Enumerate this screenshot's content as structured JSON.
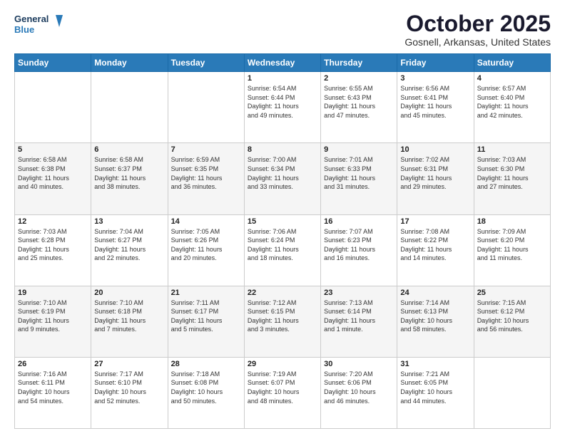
{
  "header": {
    "logo_line1": "General",
    "logo_line2": "Blue",
    "month": "October 2025",
    "location": "Gosnell, Arkansas, United States"
  },
  "weekdays": [
    "Sunday",
    "Monday",
    "Tuesday",
    "Wednesday",
    "Thursday",
    "Friday",
    "Saturday"
  ],
  "weeks": [
    [
      {
        "day": "",
        "info": ""
      },
      {
        "day": "",
        "info": ""
      },
      {
        "day": "",
        "info": ""
      },
      {
        "day": "1",
        "info": "Sunrise: 6:54 AM\nSunset: 6:44 PM\nDaylight: 11 hours\nand 49 minutes."
      },
      {
        "day": "2",
        "info": "Sunrise: 6:55 AM\nSunset: 6:43 PM\nDaylight: 11 hours\nand 47 minutes."
      },
      {
        "day": "3",
        "info": "Sunrise: 6:56 AM\nSunset: 6:41 PM\nDaylight: 11 hours\nand 45 minutes."
      },
      {
        "day": "4",
        "info": "Sunrise: 6:57 AM\nSunset: 6:40 PM\nDaylight: 11 hours\nand 42 minutes."
      }
    ],
    [
      {
        "day": "5",
        "info": "Sunrise: 6:58 AM\nSunset: 6:38 PM\nDaylight: 11 hours\nand 40 minutes."
      },
      {
        "day": "6",
        "info": "Sunrise: 6:58 AM\nSunset: 6:37 PM\nDaylight: 11 hours\nand 38 minutes."
      },
      {
        "day": "7",
        "info": "Sunrise: 6:59 AM\nSunset: 6:35 PM\nDaylight: 11 hours\nand 36 minutes."
      },
      {
        "day": "8",
        "info": "Sunrise: 7:00 AM\nSunset: 6:34 PM\nDaylight: 11 hours\nand 33 minutes."
      },
      {
        "day": "9",
        "info": "Sunrise: 7:01 AM\nSunset: 6:33 PM\nDaylight: 11 hours\nand 31 minutes."
      },
      {
        "day": "10",
        "info": "Sunrise: 7:02 AM\nSunset: 6:31 PM\nDaylight: 11 hours\nand 29 minutes."
      },
      {
        "day": "11",
        "info": "Sunrise: 7:03 AM\nSunset: 6:30 PM\nDaylight: 11 hours\nand 27 minutes."
      }
    ],
    [
      {
        "day": "12",
        "info": "Sunrise: 7:03 AM\nSunset: 6:28 PM\nDaylight: 11 hours\nand 25 minutes."
      },
      {
        "day": "13",
        "info": "Sunrise: 7:04 AM\nSunset: 6:27 PM\nDaylight: 11 hours\nand 22 minutes."
      },
      {
        "day": "14",
        "info": "Sunrise: 7:05 AM\nSunset: 6:26 PM\nDaylight: 11 hours\nand 20 minutes."
      },
      {
        "day": "15",
        "info": "Sunrise: 7:06 AM\nSunset: 6:24 PM\nDaylight: 11 hours\nand 18 minutes."
      },
      {
        "day": "16",
        "info": "Sunrise: 7:07 AM\nSunset: 6:23 PM\nDaylight: 11 hours\nand 16 minutes."
      },
      {
        "day": "17",
        "info": "Sunrise: 7:08 AM\nSunset: 6:22 PM\nDaylight: 11 hours\nand 14 minutes."
      },
      {
        "day": "18",
        "info": "Sunrise: 7:09 AM\nSunset: 6:20 PM\nDaylight: 11 hours\nand 11 minutes."
      }
    ],
    [
      {
        "day": "19",
        "info": "Sunrise: 7:10 AM\nSunset: 6:19 PM\nDaylight: 11 hours\nand 9 minutes."
      },
      {
        "day": "20",
        "info": "Sunrise: 7:10 AM\nSunset: 6:18 PM\nDaylight: 11 hours\nand 7 minutes."
      },
      {
        "day": "21",
        "info": "Sunrise: 7:11 AM\nSunset: 6:17 PM\nDaylight: 11 hours\nand 5 minutes."
      },
      {
        "day": "22",
        "info": "Sunrise: 7:12 AM\nSunset: 6:15 PM\nDaylight: 11 hours\nand 3 minutes."
      },
      {
        "day": "23",
        "info": "Sunrise: 7:13 AM\nSunset: 6:14 PM\nDaylight: 11 hours\nand 1 minute."
      },
      {
        "day": "24",
        "info": "Sunrise: 7:14 AM\nSunset: 6:13 PM\nDaylight: 10 hours\nand 58 minutes."
      },
      {
        "day": "25",
        "info": "Sunrise: 7:15 AM\nSunset: 6:12 PM\nDaylight: 10 hours\nand 56 minutes."
      }
    ],
    [
      {
        "day": "26",
        "info": "Sunrise: 7:16 AM\nSunset: 6:11 PM\nDaylight: 10 hours\nand 54 minutes."
      },
      {
        "day": "27",
        "info": "Sunrise: 7:17 AM\nSunset: 6:10 PM\nDaylight: 10 hours\nand 52 minutes."
      },
      {
        "day": "28",
        "info": "Sunrise: 7:18 AM\nSunset: 6:08 PM\nDaylight: 10 hours\nand 50 minutes."
      },
      {
        "day": "29",
        "info": "Sunrise: 7:19 AM\nSunset: 6:07 PM\nDaylight: 10 hours\nand 48 minutes."
      },
      {
        "day": "30",
        "info": "Sunrise: 7:20 AM\nSunset: 6:06 PM\nDaylight: 10 hours\nand 46 minutes."
      },
      {
        "day": "31",
        "info": "Sunrise: 7:21 AM\nSunset: 6:05 PM\nDaylight: 10 hours\nand 44 minutes."
      },
      {
        "day": "",
        "info": ""
      }
    ]
  ]
}
